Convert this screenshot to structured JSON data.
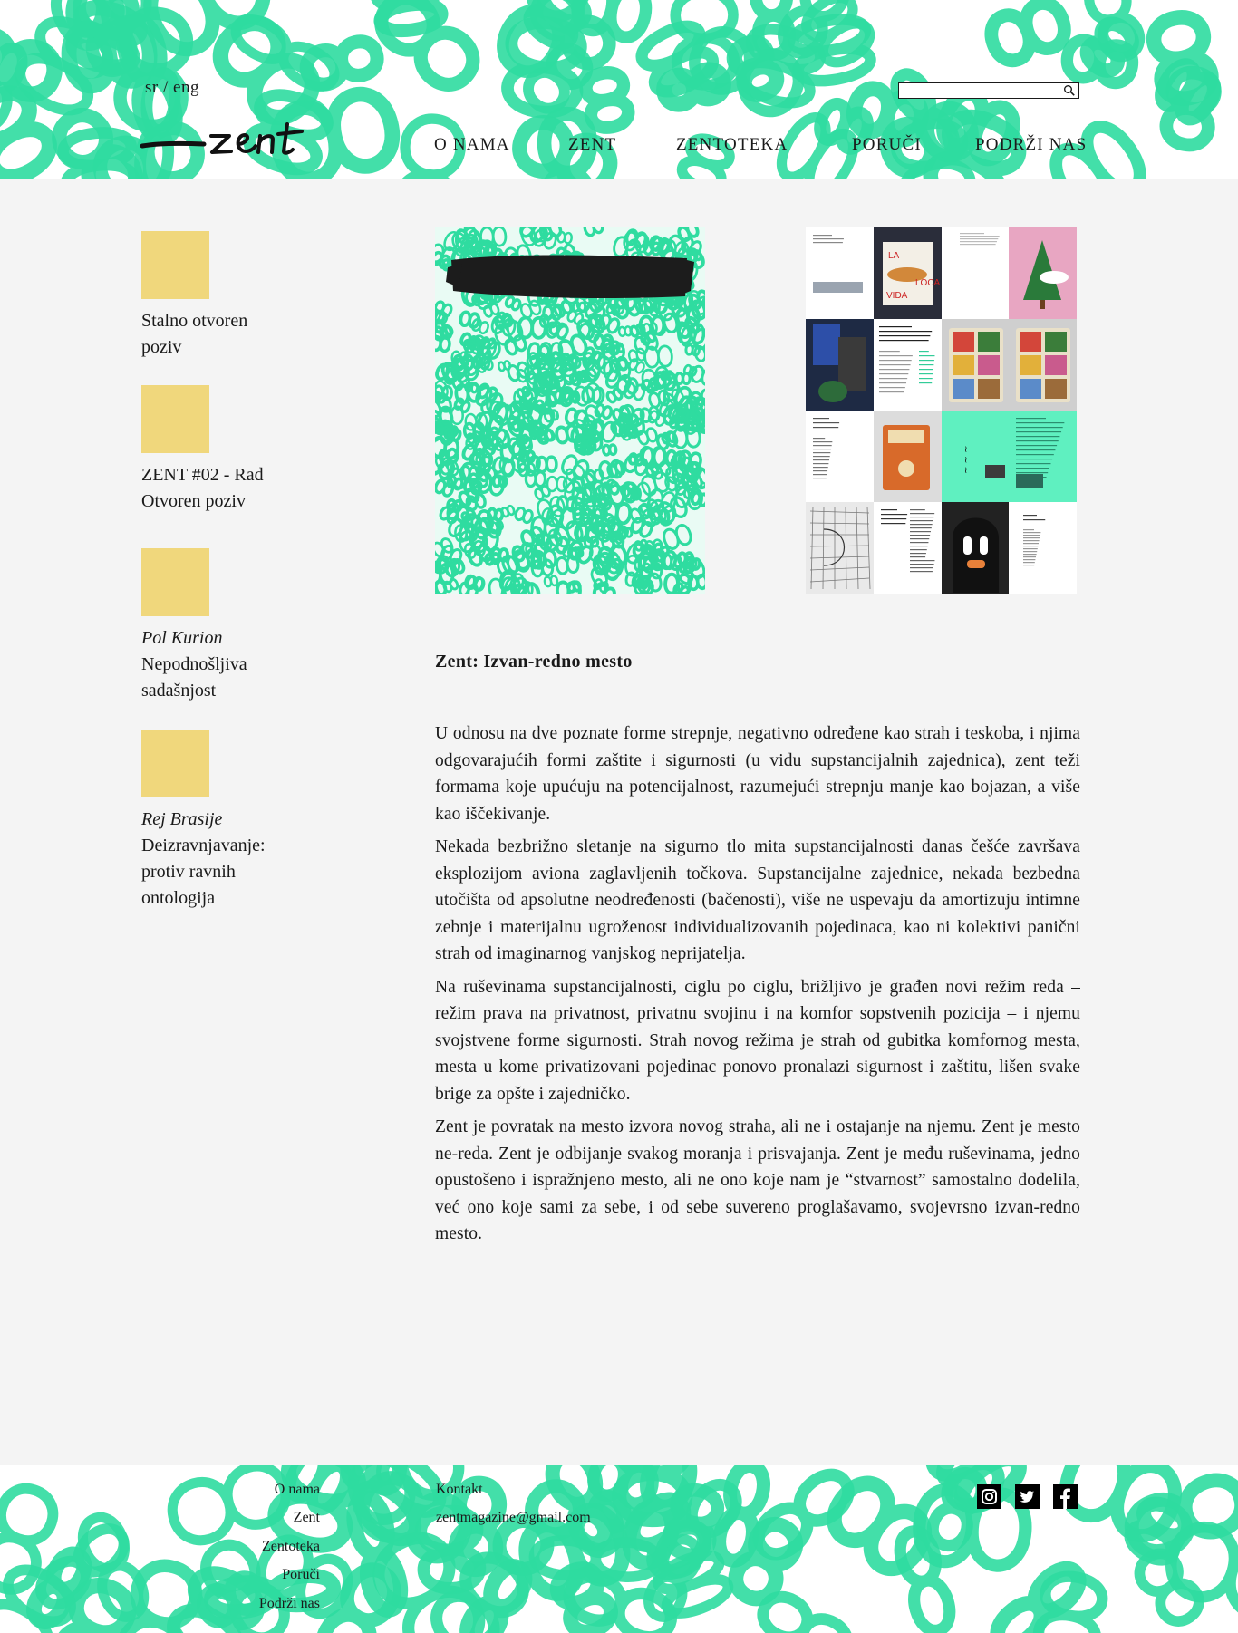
{
  "header": {
    "lang": {
      "sr": "sr",
      "sep": "/",
      "eng": "eng"
    },
    "search": {
      "placeholder": "",
      "value": ""
    },
    "nav": [
      "O NAMA",
      "ZENT",
      "ZENTOTEKA",
      "PORUČI",
      "PODRŽI NAS"
    ]
  },
  "sidebar": {
    "items": [
      {
        "lines": [
          "Stalno otvoren",
          "poziv"
        ]
      },
      {
        "lines": [
          "ZENT #02 - Rad",
          "Otvoren poziv"
        ]
      },
      {
        "author": "Pol Kurion",
        "lines": [
          "Nepodnošljiva",
          "sadašnjost"
        ]
      },
      {
        "author": "Rej Brasije",
        "lines": [
          "Deizravnjavanje:",
          "protiv ravnih",
          "ontologija"
        ]
      }
    ]
  },
  "article": {
    "title": "Zent: Izvan-redno mesto",
    "paragraphs": [
      "U odnosu na dve poznate forme strepnje, negativno određene kao strah i teskoba, i njima odgovarajućih formi zaštite i sigurnosti (u vidu supstancijalnih zajednica), zent teži formama koje upućuju na potencijalnost, razumejući strepnju manje kao bojazan, a više kao iščekivanje.",
      "Nekada bezbrižno sletanje na sigurno tlo mita supstancijalnosti danas češće završava eksplozijom aviona zaglavljenih točkova. Supstancijalne zajednice, nekada bezbedna utočišta od apsolutne neodređenosti (bačenosti), više ne uspevaju da amortizuju intimne zebnje i materijalnu ugroženost individualizovanih pojedinaca, kao ni kolektivi panični strah od imaginarnog vanjskog neprijatelja.",
      "Na ruševinama supstancijalnosti, ciglu po ciglu, brižljivo je građen novi režim reda – režim prava na privatnost, privatnu svojinu i na komfor sopstvenih pozicija – i njemu svojstvene forme sigurnosti. Strah novog režima je strah od gubitka komfornog mesta, mesta u kome privatizovani pojedinac ponovo pronalazi sigurnost i zaštitu, lišen svake brige za opšte i zajedničko.",
      "Zent je povratak na mesto izvora novog straha, ali ne i ostajanje na njemu. Zent je mesto ne-reda. Zent je odbijanje svakog moranja i prisvajanja. Zent je među ruševinama, jedno opustošeno i ispražnjeno mesto, ali ne ono koje nam je “stvarnost” samostalno dodelila, već ono koje sami za sebe, i od sebe suvereno proglašavamo, svojevrsno izvan-redno mesto."
    ]
  },
  "gallery": {
    "cells": [
      {
        "bg": "#ffffff",
        "kind": "text"
      },
      {
        "bg": "#2a2d3a",
        "kind": "lavida",
        "text": [
          "LA",
          "VIDA",
          "LOCA"
        ]
      },
      {
        "bg": "#ffffff",
        "kind": "text-small"
      },
      {
        "bg": "#e8a6c2",
        "kind": "tree"
      },
      {
        "bg": "#1e2a44",
        "kind": "plant"
      },
      {
        "bg": "#ffffff",
        "kind": "handtext"
      },
      {
        "bg": "#cfcfcf",
        "kind": "cards"
      },
      {
        "bg": "#cfcfcf",
        "kind": "cards"
      },
      {
        "bg": "#ffffff",
        "kind": "poem"
      },
      {
        "bg": "#dcdcdc",
        "kind": "book"
      },
      {
        "bg": "#5ff0c0",
        "kind": "script"
      },
      {
        "bg": "#5ff0c0",
        "kind": "text-green"
      },
      {
        "bg": "#e9e9e9",
        "kind": "map"
      },
      {
        "bg": "#ffffff",
        "kind": "column"
      },
      {
        "bg": "#222222",
        "kind": "face"
      },
      {
        "bg": "#ffffff",
        "kind": "list"
      }
    ]
  },
  "footer": {
    "links": [
      "O nama",
      "Zent",
      "Zentoteka",
      "Poruči",
      "Podrži nas"
    ],
    "contact_label": "Kontakt",
    "email": "zentmagazine@gmail.com",
    "social": [
      "instagram-icon",
      "twitter-icon",
      "facebook-icon"
    ]
  },
  "colors": {
    "accent": "#2fdca0",
    "thumb": "#f0d77c",
    "bg": "#f4f4f4",
    "text": "#1a1a1a"
  }
}
